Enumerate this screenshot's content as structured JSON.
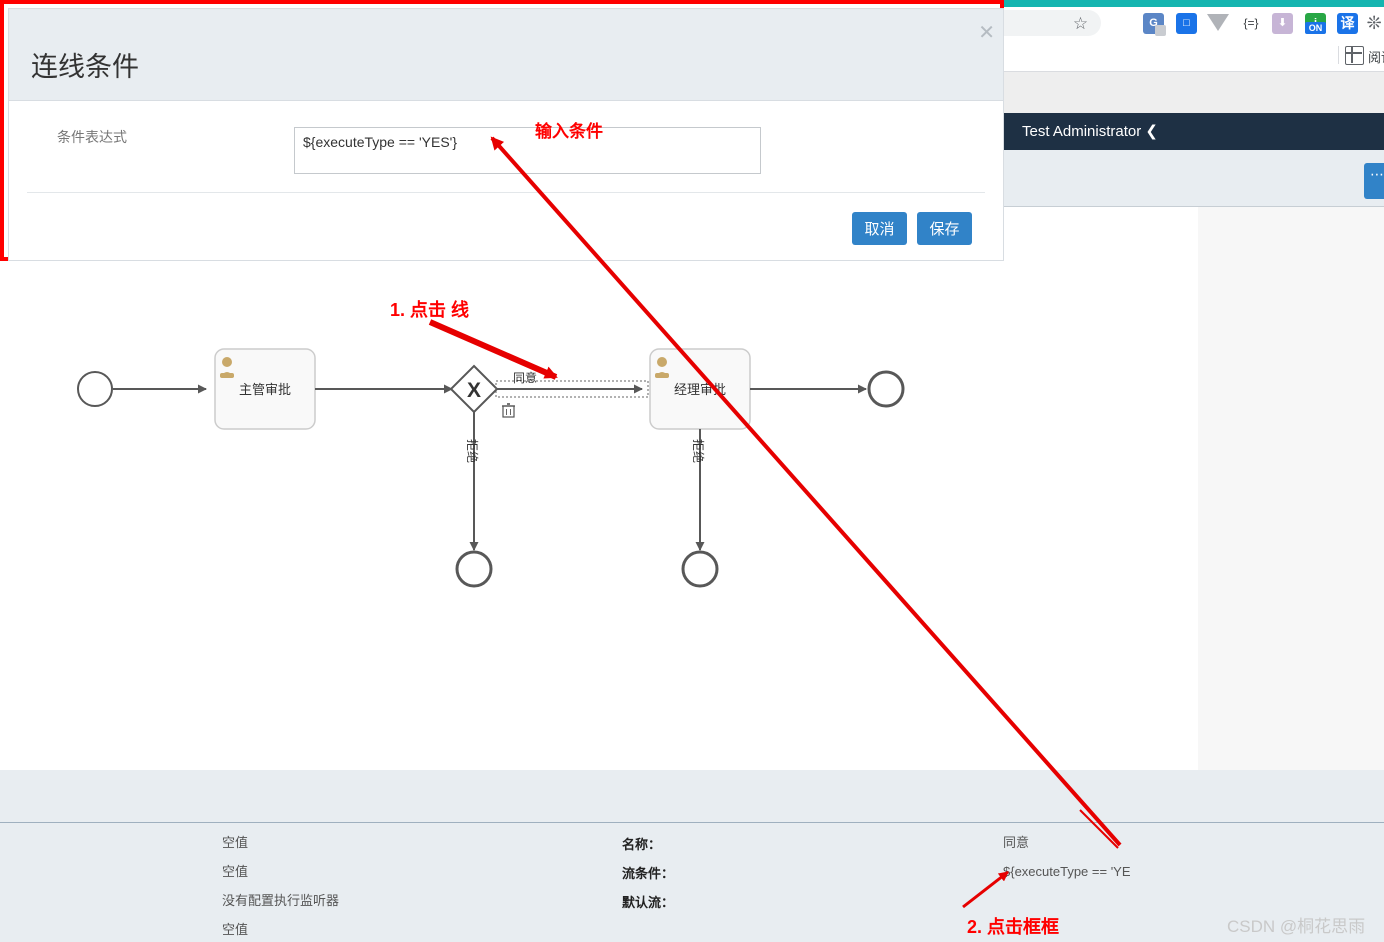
{
  "browser": {
    "omnibox_icons": [
      "star-icon"
    ],
    "extensions": [
      {
        "name": "google-translate-extension-icon",
        "glyph": "G"
      },
      {
        "name": "bookmark-manager-extension-icon",
        "glyph": "□"
      },
      {
        "name": "vue-devtools-extension-icon",
        "glyph": "V"
      },
      {
        "name": "json-viewer-extension-icon",
        "glyph": "{=}"
      },
      {
        "name": "pocket-extension-icon",
        "glyph": "⬇"
      },
      {
        "name": "adblock-on-extension-icon",
        "glyph": "i",
        "badge": "ON"
      },
      {
        "name": "translate-extension-icon",
        "glyph": "译"
      },
      {
        "name": "extensions-puzzle-icon",
        "glyph": "✦"
      }
    ],
    "bookmarks_bar": {
      "grid_icon": "reading-list-grid-icon",
      "label": "阅读"
    }
  },
  "app": {
    "navbar": {
      "user": "Test Administrator",
      "caret": "♥"
    },
    "subbar": {
      "action_button": "➕"
    }
  },
  "dialog": {
    "title": "连线条件",
    "close_label": "✕",
    "field_label": "条件表达式",
    "field_value": "${executeType == 'YES'}",
    "field_placeholder": "",
    "cancel_label": "取消",
    "save_label": "保存"
  },
  "annotations": [
    {
      "id": "anno-input",
      "text": "输入条件"
    },
    {
      "id": "anno-step1",
      "text": "1. 点击 线"
    },
    {
      "id": "anno-step2",
      "text": "2. 点击框框"
    }
  ],
  "diagram": {
    "type": "bpmn",
    "nodes": [
      {
        "name": "start-event",
        "kind": "circle",
        "label": ""
      },
      {
        "name": "task-manager-approval",
        "kind": "user-task",
        "label": "主管审批"
      },
      {
        "name": "exclusive-gateway",
        "kind": "gateway",
        "label": "X"
      },
      {
        "name": "task-director-approval",
        "kind": "user-task",
        "label": "经理审批"
      },
      {
        "name": "end-event-right",
        "kind": "circle",
        "label": ""
      },
      {
        "name": "end-event-gateway-reject",
        "kind": "circle",
        "label": ""
      },
      {
        "name": "end-event-task-reject",
        "kind": "circle",
        "label": ""
      }
    ],
    "flows": [
      {
        "name": "flow-agree",
        "label": "同意",
        "selected": true
      },
      {
        "name": "flow-gateway-reject",
        "label": "拒绝"
      },
      {
        "name": "flow-task-reject",
        "label": "拒绝"
      }
    ],
    "selected_flow_tools": [
      "delete-trash-icon"
    ]
  },
  "properties": {
    "values": [
      "空值",
      "空值",
      "没有配置执行监听器",
      "空值"
    ],
    "labels": [
      "名称：",
      "流条件：",
      "默认流："
    ],
    "right_values": [
      "同意",
      "${executeType ==  'YE"
    ]
  },
  "watermark": "CSDN @桐花思雨",
  "colors": {
    "accent_blue": "#3183c8",
    "navbar_dark": "#1e3044",
    "panel_bg": "#e8edf1",
    "annotation_red": "#ff0000",
    "chrome_teal": "#15b5b0"
  }
}
